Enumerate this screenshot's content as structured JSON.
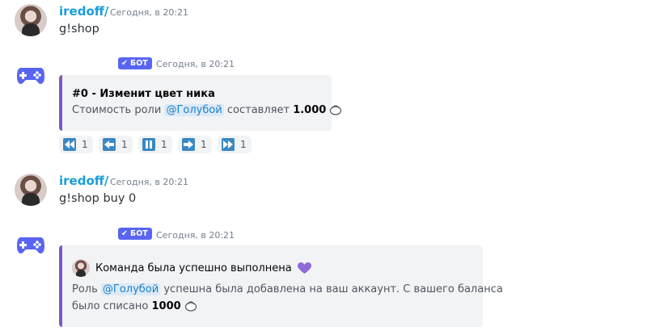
{
  "messages": {
    "m1": {
      "author": "iredoff/",
      "timestamp": "Сегодня, в 20:21",
      "content": "g!shop"
    },
    "m2": {
      "badge": "БОТ",
      "timestamp": "Сегодня, в 20:21",
      "embed_title": "#0 - Изменит цвет ника",
      "embed_text_before": "Стоимость роли",
      "mention": "@Голубой",
      "embed_text_middle": "составляет",
      "amount": "1.000",
      "reactions": [
        {
          "icon": "rewind-first-icon",
          "count": "1"
        },
        {
          "icon": "arrow-left-icon",
          "count": "1"
        },
        {
          "icon": "pause-icon",
          "count": "1"
        },
        {
          "icon": "arrow-right-icon",
          "count": "1"
        },
        {
          "icon": "fast-forward-last-icon",
          "count": "1"
        }
      ]
    },
    "m3": {
      "author": "iredoff/",
      "timestamp": "Сегодня, в 20:21",
      "content": "g!shop buy 0"
    },
    "m4": {
      "badge": "БОТ",
      "timestamp": "Сегодня, в 20:21",
      "embed_author": "Команда была успешно выполнена",
      "line1_before": "Роль",
      "mention": "@Голубой",
      "line1_after": "успешна была добавлена на ваш аккаунт. С вашего баланса",
      "line2_before": "было списано",
      "amount": "1000"
    }
  },
  "colors": {
    "accent": "#5865f2",
    "username": "#1a9dd9",
    "embed_border": "#7e57c2",
    "reaction_icon": "#3b88c3",
    "heart": "#8e6bd6"
  }
}
